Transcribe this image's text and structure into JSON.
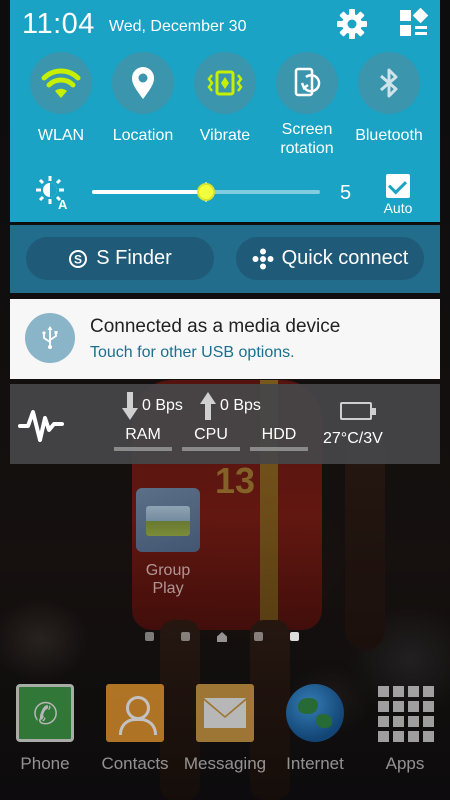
{
  "status_bar": {
    "time": "11:04",
    "date": "Wed, December 30"
  },
  "quick_settings": {
    "toggles": [
      {
        "label": "WLAN",
        "icon": "wifi-icon",
        "active": true
      },
      {
        "label": "Location",
        "icon": "location-pin-icon",
        "active": false
      },
      {
        "label": "Vibrate",
        "icon": "vibrate-icon",
        "active": true
      },
      {
        "label": "Screen\nrotation",
        "icon": "screen-rotation-icon",
        "active": false
      },
      {
        "label": "Bluetooth",
        "icon": "bluetooth-icon",
        "active": false
      }
    ],
    "brightness": {
      "value": "5",
      "level_fraction": 0.5,
      "auto_label": "Auto",
      "auto_checked": true
    }
  },
  "finder": {
    "s_finder_label": "S Finder",
    "quick_connect_label": "Quick connect"
  },
  "notification": {
    "title": "Connected as a media device",
    "subtitle": "Touch for other USB options."
  },
  "monitor": {
    "download": "0 Bps",
    "upload": "0 Bps",
    "ram_label": "RAM",
    "cpu_label": "CPU",
    "hdd_label": "HDD",
    "temp_voltage": "27°C/3V"
  },
  "home": {
    "folder_label": "Group Play",
    "dock": [
      {
        "label": "Phone",
        "icon": "phone-icon"
      },
      {
        "label": "Contacts",
        "icon": "contacts-icon"
      },
      {
        "label": "Messaging",
        "icon": "messaging-icon"
      },
      {
        "label": "Internet",
        "icon": "internet-globe-icon"
      },
      {
        "label": "Apps",
        "icon": "apps-grid-icon"
      }
    ]
  },
  "colors": {
    "shade_accent": "#1aa3c4",
    "toggle_active": "#c6f000",
    "slider_thumb": "#f2ff3c",
    "finder_bar": "#226c8c"
  }
}
